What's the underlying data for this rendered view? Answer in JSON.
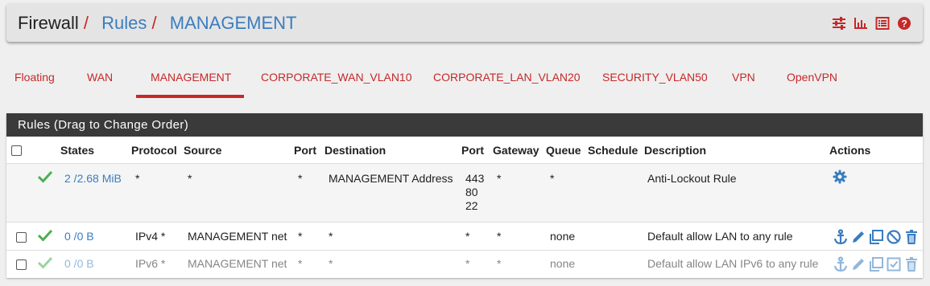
{
  "breadcrumb": {
    "root": "Firewall",
    "section": "Rules",
    "current": "MANAGEMENT",
    "sep": "/"
  },
  "tabs": [
    {
      "label": "Floating"
    },
    {
      "label": "WAN"
    },
    {
      "label": "MANAGEMENT",
      "active": true
    },
    {
      "label": "CORPORATE_WAN_VLAN10"
    },
    {
      "label": "CORPORATE_LAN_VLAN20"
    },
    {
      "label": "SECURITY_VLAN50"
    },
    {
      "label": "VPN"
    },
    {
      "label": "OpenVPN"
    }
  ],
  "panel": {
    "title": "Rules (Drag to Change Order)",
    "columns": {
      "states": "States",
      "protocol": "Protocol",
      "source": "Source",
      "port": "Port",
      "destination": "Destination",
      "dport": "Port",
      "gateway": "Gateway",
      "queue": "Queue",
      "schedule": "Schedule",
      "description": "Description",
      "actions": "Actions"
    },
    "rows": [
      {
        "states": "2 /2.68 MiB",
        "protocol": "*",
        "source": "*",
        "port": "*",
        "destination": "MANAGEMENT Address",
        "dport_lines": [
          "443",
          "80",
          "22"
        ],
        "gateway": "*",
        "queue": "*",
        "schedule": "",
        "description": "Anti-Lockout Rule"
      },
      {
        "states": "0 /0 B",
        "protocol": "IPv4 *",
        "source": "MANAGEMENT net",
        "port": "*",
        "destination": "*",
        "dport": "*",
        "gateway": "*",
        "queue": "none",
        "schedule": "",
        "description": "Default allow LAN to any rule"
      },
      {
        "states": "0 /0 B",
        "protocol": "IPv6 *",
        "source": "MANAGEMENT net",
        "port": "*",
        "destination": "*",
        "dport": "*",
        "gateway": "*",
        "queue": "none",
        "schedule": "",
        "description": "Default allow LAN IPv6 to any rule",
        "disabled": true
      }
    ]
  },
  "colors": {
    "accent": "#c62828",
    "link": "#3a7dbf",
    "pass": "#4caf50",
    "panel_head": "#3a3a3a"
  },
  "icons": [
    "sliders-icon",
    "bar-chart-icon",
    "list-icon",
    "help-icon",
    "check-icon",
    "gear-icon",
    "anchor-icon",
    "pencil-icon",
    "copy-icon",
    "disable-icon",
    "trash-icon"
  ]
}
